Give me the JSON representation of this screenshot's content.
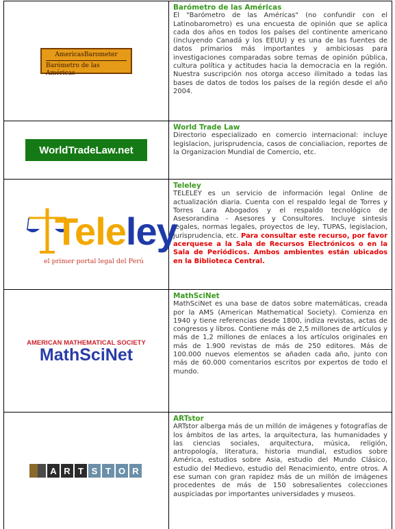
{
  "resources": [
    {
      "title": "Barómetro de las Américas",
      "description": "El \"Barómetro de las Américas\" (no confundir con el Latinobarometro) es una encuesta de opinión que se aplica cada dos años en todos los países del continente americano (incluyendo Canadá y los EEUU) y es una de las fuentes de datos primarios más importantes y ambiciosas para investigaciones comparadas sobre temas de opinión pública, cultura política y actitudes hacia la democracia en la región. Nuestra suscripción nos otorga acceso ilimitado a todas las bases de datos de todos los países de la región desde el año 2004.",
      "logo": {
        "line1": "AmericasBarometer",
        "line2": "Barómetro de las Américas",
        "bg": "#e59a18"
      }
    },
    {
      "title": "World Trade Law",
      "description": "Directorio especializado en comercio internacional: incluye legislacion, jurisprudencia, casos de concialiacion, reportes de la Organizacion Mundial de Comercio, etc.",
      "logo": {
        "text": "WorldTradeLaw.net",
        "bg": "#157a15"
      }
    },
    {
      "title": "Teleley",
      "description": "TELELEY es un servicio de información legal Online de actualización diaria. Cuenta con el respaldo legal de Torres y Torres Lara Abogados y el respaldo tecnológico de Asesorandina - Asesores y Consultores. Incluye sintesis legales, normas legales, proyectos de ley, TUPAS, legislacion, jurisprudencia, etc.",
      "alert": "Para consultar este recurso, por favor acerquese a la Sala de Recursos Electrónicos o en la Sala de Periódicos. Ambos ambientes están ubicados en la Biblioteca Central.",
      "logo": {
        "part1": "Tele",
        "part2": "ley",
        "tagline": "el primer portal legal del Perú"
      }
    },
    {
      "title": "MathSciNet",
      "description": "MathSciNet es una base de datos sobre matemáticas, creada por la AMS (American Mathematical Society). Comienza en 1940 y tiene referencias desde 1800, indiza revistas, actas de congresos y libros. Contiene más de 2,5 millones de artículos y más de 1,2 millones de enlaces a los artículos originales en más de 1.900 revistas de más de 250 editores. Más de 100.000 nuevos elementos se añaden cada año, junto con más de 60.000 comentarios escritos por expertos de todo el mundo.",
      "logo": {
        "top": "AMERICAN MATHEMATICAL SOCIETY",
        "main": "MathSciNet"
      }
    },
    {
      "title": "ARTstor",
      "description": "ARTstor alberga más de un millón de imágenes y fotografías de los ámbitos de las artes, la arquitectura, las humanidades y las ciencias sociales, arquitectura, música, religión, antropología, literatura, historia mundial, estudios sobre América, estudios sobre Asia, estudio del Mundo Clásico, estudio del Medievo, estudio del Renacimiento, entre otros. A ese suman con gran rapidez más de un millón de imágenes procedentes de más de 150 sobresalientes colecciones auspiciadas por importantes universidades y museos.",
      "logo": {
        "letters": [
          "A",
          "R",
          "T",
          "S",
          "T",
          "O",
          "R"
        ],
        "colors": [
          "#2b2b2b",
          "#2b2b2b",
          "#2b2b2b",
          "#6b8fa8",
          "#6b8fa8",
          "#6b8fa8",
          "#6b8fa8"
        ]
      }
    }
  ]
}
